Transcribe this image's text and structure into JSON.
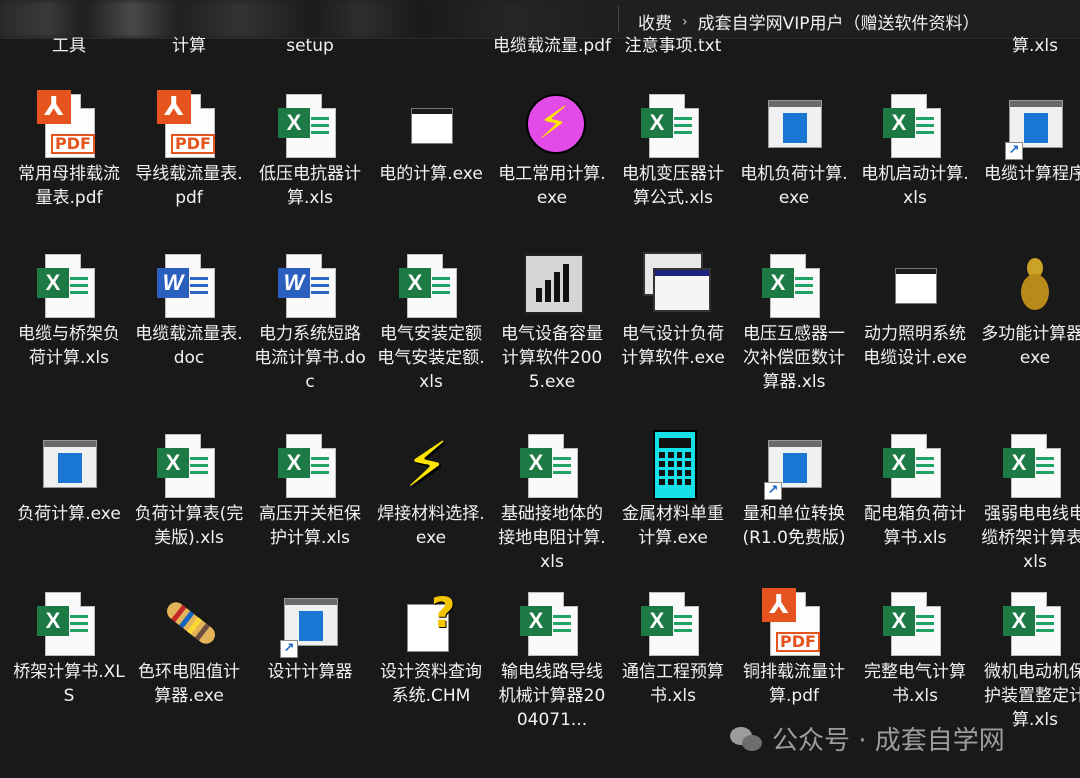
{
  "breadcrumb": {
    "segments": [
      "收费",
      "成套自学网VIP用户（赠送软件资料）"
    ]
  },
  "partial_top": [
    "工具",
    "计算",
    "setup",
    "电缆载流量.pdf",
    "注意事项.txt",
    "算.xls"
  ],
  "rows": [
    [
      {
        "label": "常用母排载流量表.pdf",
        "icon": "pdf"
      },
      {
        "label": "导线载流量表.pdf",
        "icon": "pdf"
      },
      {
        "label": "低压电抗器计算.xls",
        "icon": "excel"
      },
      {
        "label": "电的计算.exe",
        "icon": "exe-window"
      },
      {
        "label": "电工常用计算.exe",
        "icon": "exe-lightning"
      },
      {
        "label": "电机变压器计算公式.xls",
        "icon": "excel"
      },
      {
        "label": "电机负荷计算.exe",
        "icon": "app-window"
      },
      {
        "label": "电机启动计算.xls",
        "icon": "excel"
      },
      {
        "label": "电缆计算程序",
        "icon": "shortcut-window"
      }
    ],
    [
      {
        "label": "电缆与桥架负荷计算.xls",
        "icon": "excel"
      },
      {
        "label": "电缆载流量表.doc",
        "icon": "word"
      },
      {
        "label": "电力系统短路电流计算书.doc",
        "icon": "word"
      },
      {
        "label": "电气安装定额电气安装定额.xls",
        "icon": "excel"
      },
      {
        "label": "电气设备容量计算软件2005.exe",
        "icon": "chart-app"
      },
      {
        "label": "电气设计负荷计算软件.exe",
        "icon": "dual-window"
      },
      {
        "label": "电压互感器一次补偿匝数计算器.xls",
        "icon": "excel"
      },
      {
        "label": "动力照明系统电缆设计.exe",
        "icon": "exe-window"
      },
      {
        "label": "多功能计算器.exe",
        "icon": "gourd"
      }
    ],
    [
      {
        "label": "负荷计算.exe",
        "icon": "app-window"
      },
      {
        "label": "负荷计算表(完美版).xls",
        "icon": "excel"
      },
      {
        "label": "高压开关柜保护计算.xls",
        "icon": "excel"
      },
      {
        "label": "焊接材料选择.exe",
        "icon": "bolt"
      },
      {
        "label": "基础接地体的接地电阻计算.xls",
        "icon": "excel"
      },
      {
        "label": "金属材料单重计算.exe",
        "icon": "calculator"
      },
      {
        "label": "量和单位转换(R1.0免费版)",
        "icon": "shortcut-window"
      },
      {
        "label": "配电箱负荷计算书.xls",
        "icon": "excel"
      },
      {
        "label": "强弱电电线电缆桥架计算表.xls",
        "icon": "excel"
      }
    ],
    [
      {
        "label": "桥架计算书.XLS",
        "icon": "excel"
      },
      {
        "label": "色环电阻值计算器.exe",
        "icon": "resistor"
      },
      {
        "label": "设计计算器",
        "icon": "shortcut-window"
      },
      {
        "label": "设计资料查询系统.CHM",
        "icon": "chm"
      },
      {
        "label": "输电线路导线机械计算器2004071...",
        "icon": "excel"
      },
      {
        "label": "通信工程预算书.xls",
        "icon": "excel"
      },
      {
        "label": "铜排载流量计算.pdf",
        "icon": "pdf"
      },
      {
        "label": "完整电气计算书.xls",
        "icon": "excel"
      },
      {
        "label": "微机电动机保护装置整定计算.xls",
        "icon": "excel"
      }
    ]
  ],
  "watermark": {
    "text": "公众号 · 成套自学网"
  }
}
